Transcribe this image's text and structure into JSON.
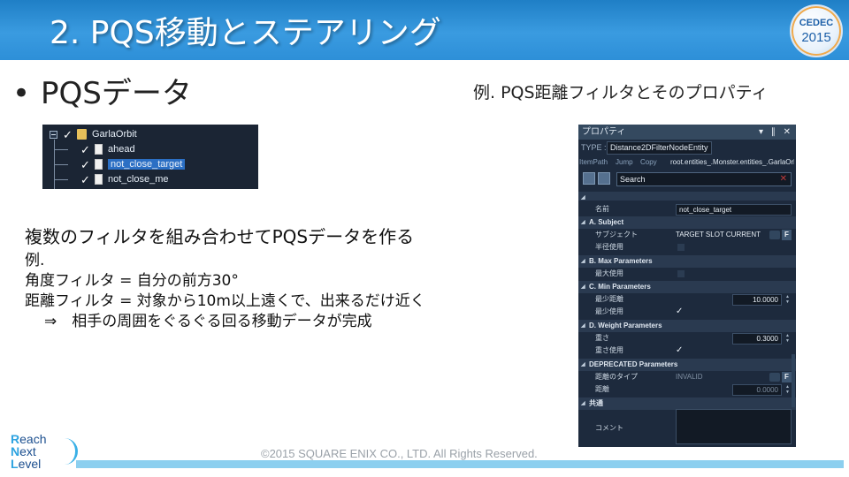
{
  "header": {
    "title": "2. PQS移動とステアリング",
    "badge_line1": "CEDEC",
    "badge_line2": "2015"
  },
  "bullet": {
    "mark": "•",
    "text": "PQSデータ"
  },
  "example_caption": "例. PQS距離フィルタとそのプロパティ",
  "tree": {
    "root_label": "GarlaOrbit",
    "children": [
      {
        "label": "ahead",
        "selected": false
      },
      {
        "label": "not_close_target",
        "selected": true
      },
      {
        "label": "not_close_me",
        "selected": false
      }
    ]
  },
  "body": {
    "line1": "複数のフィルタを組み合わせてPQSデータを作る",
    "line2": "例.",
    "line3": "角度フィルタ = 自分の前方30°",
    "line4": "距離フィルタ = 対象から10m以上遠くで、出来るだけ近く",
    "line5": "⇒　相手の周囲をぐるぐる回る移動データが完成"
  },
  "property_panel": {
    "title": "プロパティ",
    "title_controls": "▾ ∥ ✕",
    "type_label": "TYPE :",
    "type_value": "Distance2DFilterNodeEntity",
    "itempath_label": "ItemPath",
    "jump_label": "Jump",
    "copy_label": "Copy",
    "path_value": "root.entities_.Monster.entities_.GarlaOrb",
    "search_placeholder": "Search",
    "name_label": "名前",
    "name_value": "not_close_target",
    "sections": {
      "a": "A. Subject",
      "b": "B. Max Parameters",
      "c": "C. Min Parameters",
      "d": "D. Weight Parameters",
      "dep": "DEPRECATED Parameters",
      "common": "共通"
    },
    "rows": {
      "subject_label": "サブジェクト",
      "subject_value": "TARGET SLOT CURRENT",
      "radius_label": "半径使用",
      "max_use_label": "最大使用",
      "min_dist_label": "最少距離",
      "min_dist_value": "10.0000",
      "min_use_label": "最少使用",
      "weight_label": "重さ",
      "weight_value": "0.3000",
      "weight_use_label": "重さ使用",
      "dist_type_label": "距離のタイプ",
      "dist_type_value": "INVALID",
      "dist_label": "距離",
      "dist_value": "0.0000",
      "comment_label": "コメント",
      "f_button": "F"
    }
  },
  "footer": {
    "logo_words": [
      {
        "cap": "R",
        "rest": "each"
      },
      {
        "cap": "N",
        "rest": "ext"
      },
      {
        "cap": "L",
        "rest": "evel"
      }
    ],
    "copyright": "©2015 SQUARE ENIX CO., LTD. All Rights Reserved."
  }
}
